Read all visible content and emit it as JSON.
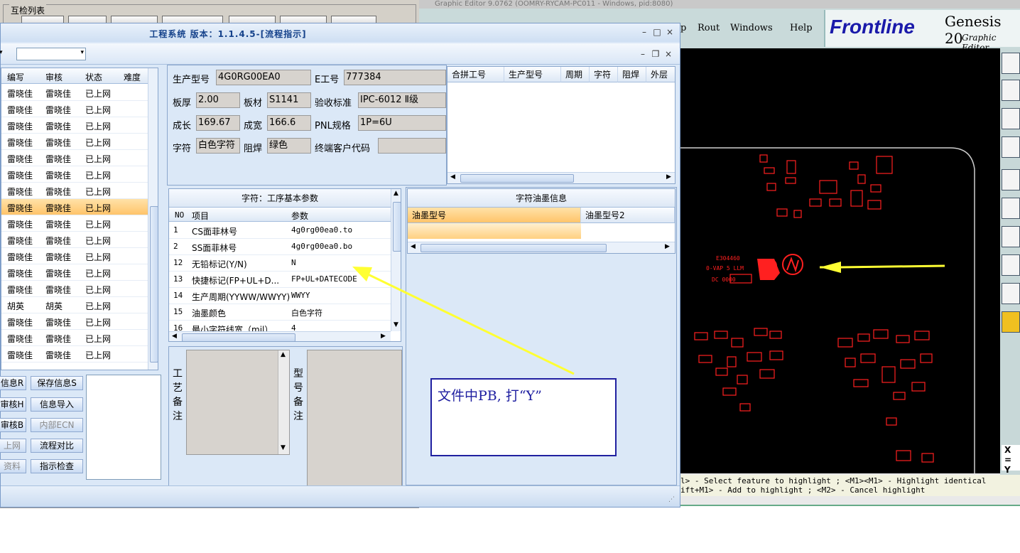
{
  "background_window": {
    "group_title": "互检列表"
  },
  "genesis": {
    "title": "Graphic Editor 9.0762 (OOMRY-RYCAM-PC011 - Windows, pid:8080)",
    "menus": [
      "p",
      "Rout",
      "Windows",
      "Help"
    ],
    "logo_text": "Frontline",
    "product": "Genesis 20",
    "product_sub": "Graphic Editor",
    "status_line1": "l> - Select feature to highlight ; <M1><M1> - Highlight identical",
    "status_line2": "ift+M1> - Add to highlight ; <M2> - Cancel highlight",
    "coord_x": "X =",
    "coord_y": "Y ="
  },
  "main": {
    "title": "工程系统 版本：1.1.4.5-[流程指示]",
    "left_grid": {
      "headers": [
        "编写",
        "审核",
        "状态",
        "难度"
      ],
      "rows": [
        [
          "雷晓佳",
          "雷晓佳",
          "已上网"
        ],
        [
          "雷晓佳",
          "雷晓佳",
          "已上网"
        ],
        [
          "雷晓佳",
          "雷晓佳",
          "已上网"
        ],
        [
          "雷晓佳",
          "雷晓佳",
          "已上网"
        ],
        [
          "雷晓佳",
          "雷晓佳",
          "已上网"
        ],
        [
          "雷晓佳",
          "雷晓佳",
          "已上网"
        ],
        [
          "雷晓佳",
          "雷晓佳",
          "已上网"
        ],
        [
          "雷晓佳",
          "雷晓佳",
          "已上网"
        ],
        [
          "雷晓佳",
          "雷晓佳",
          "已上网"
        ],
        [
          "雷晓佳",
          "雷晓佳",
          "已上网"
        ],
        [
          "雷晓佳",
          "雷晓佳",
          "已上网"
        ],
        [
          "雷晓佳",
          "雷晓佳",
          "已上网"
        ],
        [
          "雷晓佳",
          "雷晓佳",
          "已上网"
        ],
        [
          "胡英",
          "胡英",
          "已上网"
        ],
        [
          "雷晓佳",
          "雷晓佳",
          "已上网"
        ],
        [
          "雷晓佳",
          "雷晓佳",
          "已上网"
        ],
        [
          "雷晓佳",
          "雷晓佳",
          "已上网"
        ]
      ]
    },
    "left_buttons": {
      "b1": "信息R",
      "b2": "保存信息S",
      "b3": "审核H",
      "b4": "信息导入",
      "b5": "审核B",
      "b6": "内部ECN",
      "b7": "上网",
      "b8": "流程对比",
      "b9": "资料",
      "b10": "指示检查"
    },
    "info": {
      "model_label": "生产型号",
      "model_value": "4G0RG00EA0",
      "eno_label": "E工号",
      "eno_value": "777384",
      "thick_label": "板厚",
      "thick_value": "2.00",
      "material_label": "板材",
      "material_value": "S1141",
      "standard_label": "验收标准",
      "standard_value": "IPC-6012 Ⅱ级",
      "length_label": "成长",
      "length_value": "169.67",
      "width_label": "成宽",
      "width_value": "166.6",
      "pnl_label": "PNL规格",
      "pnl_value": "1P=6U",
      "char_label": "字符",
      "char_value": "白色字符",
      "mask_label": "阻焊",
      "mask_value": "绿色",
      "customer_label": "终端客户代码",
      "customer_value": ""
    },
    "combined_grid": {
      "headers": [
        "合拼工号",
        "生产型号",
        "周期",
        "字符",
        "阻焊",
        "外层"
      ]
    },
    "param_grid": {
      "title": "字符：工序基本参数",
      "headers": [
        "NO",
        "项目",
        "参数"
      ],
      "rows": [
        [
          "1",
          "CS面菲林号",
          "4g0rg00ea0.to"
        ],
        [
          "2",
          "SS面菲林号",
          "4g0rg00ea0.bo"
        ],
        [
          "12",
          "无铅标记(Y/N)",
          "N"
        ],
        [
          "13",
          "快捷标记(FP+UL+D...",
          "FP+UL+DATECODE"
        ],
        [
          "14",
          "生产周期(YYWW/WWYY)",
          "WWYY"
        ],
        [
          "15",
          "油墨颜色",
          "白色字符"
        ],
        [
          "16",
          "最小字符线宽（mil）",
          "4"
        ]
      ]
    },
    "ink_grid": {
      "title": "字符油墨信息",
      "headers": [
        "油墨型号",
        "油墨型号2"
      ]
    },
    "remarks": {
      "process_label": "工艺备注",
      "model_label": "型号备注"
    }
  },
  "annotation": {
    "note": "文件中PB, 打“Y”"
  }
}
